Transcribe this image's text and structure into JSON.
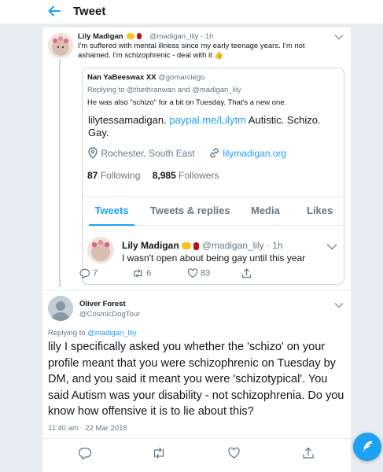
{
  "header": {
    "title": "Tweet"
  },
  "tweet1": {
    "name": "Lily Madigan",
    "handle": "@madigan_lily",
    "time": "· 1h",
    "text": "I'm suffered with mental illness since my early teenage years. I'm not ashamed. I'm schizophrenic - deal with it 👍",
    "quoted": {
      "name": "Nan YaBeeswax XX",
      "handle": "@gomarciego",
      "replying": "Replying to @thethranwan and @madigan_lily",
      "text": "He was also \"schizo\" for a bit on Tuesday. That's a new one.",
      "profile": {
        "bio_name": "lilytessamadigan.",
        "bio_link": "paypal.me/Lilytm",
        "bio_rest": "Autistic. Schizo.",
        "bio_line2": "Gay.",
        "location": "Rochester, South East",
        "website": "lilymadigan.org",
        "following_count": "87",
        "following_label": "Following",
        "followers_count": "8,985",
        "followers_label": "Followers",
        "tabs": [
          "Tweets",
          "Tweets & replies",
          "Media",
          "Likes"
        ],
        "pinned_name": "Lily Madigan",
        "pinned_handle": "@madigan_lily",
        "pinned_time": "· 1h",
        "pinned_text": "I wasn't open about being gay until this year"
      }
    },
    "actions": {
      "replies": "7",
      "retweets": "6",
      "likes": "83"
    }
  },
  "tweet2": {
    "name": "Oliver Forest",
    "handle": "@CosmicDogTour",
    "replying_prefix": "Replying to",
    "replying_handle": "@madigan_lily",
    "text": "lily I specifically asked you whether the 'schizo' on your profile meant that you were schizophrenic on Tuesday by DM, and you said it meant you were 'schizotypical'. You said Autism was your disability - not schizophrenia. Do you know how offensive it is to lie about this?",
    "timestamp": "11:40 am · 22 Mar 2018"
  },
  "icons": {
    "back": "back-arrow-icon",
    "chevron": "chevron-down-icon",
    "reply": "reply-icon",
    "retweet": "retweet-icon",
    "like": "heart-icon",
    "share": "share-icon",
    "compose": "compose-feather-icon",
    "location": "location-pin-icon",
    "website": "link-icon"
  },
  "colors": {
    "accent": "#1da1f2",
    "muted": "#657786",
    "background": "#e6ecf0",
    "rose": "#b3121f",
    "raised_hands": "#f7c325"
  }
}
